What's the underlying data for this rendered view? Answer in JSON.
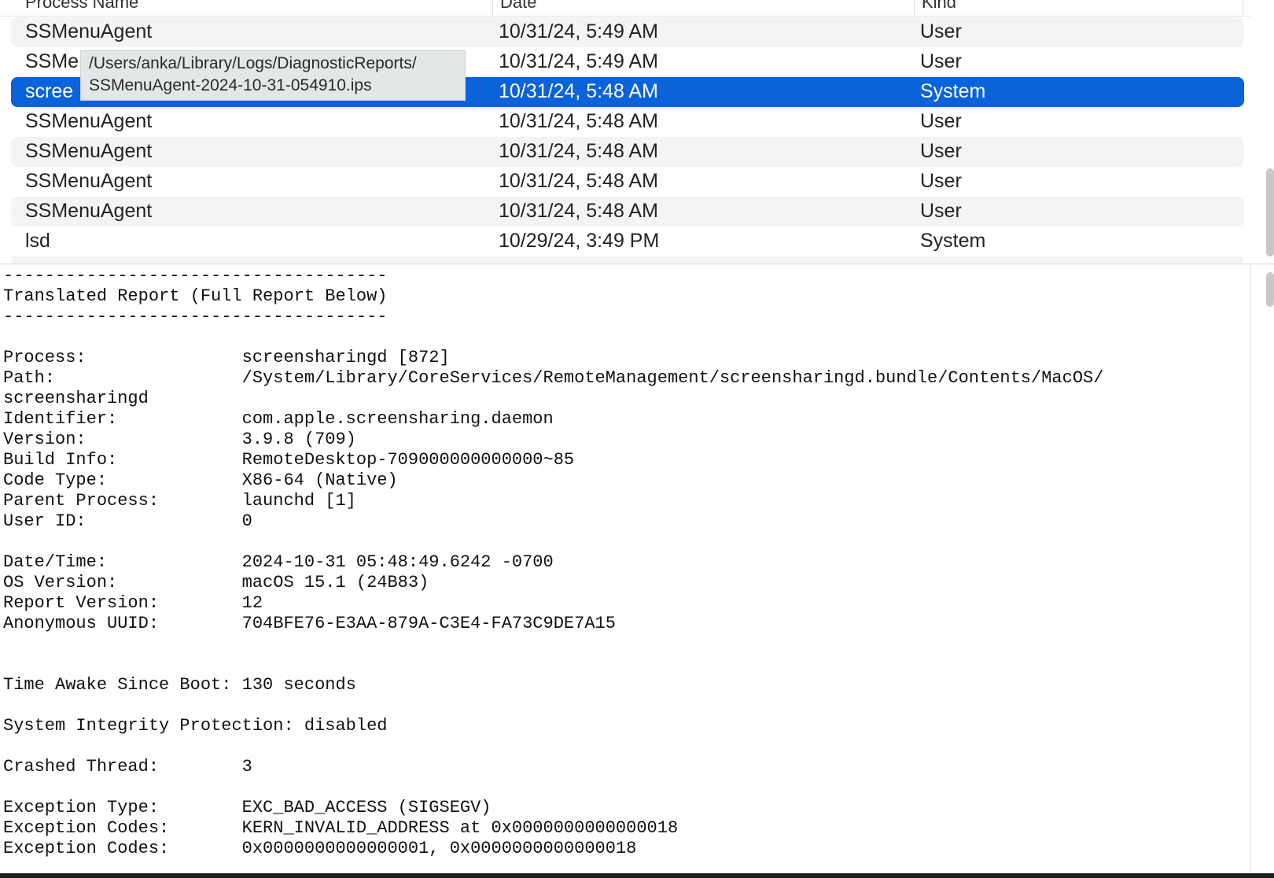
{
  "list": {
    "headers": [
      "Process Name",
      "Date",
      "Kind"
    ],
    "rows": [
      {
        "process": "SSMenuAgent",
        "date": "10/31/24, 5:49 AM",
        "kind": "User"
      },
      {
        "process": "SSMe",
        "date": "10/31/24, 5:49 AM",
        "kind": "User"
      },
      {
        "process": "scree",
        "date": "10/31/24, 5:48 AM",
        "kind": "System"
      },
      {
        "process": "SSMenuAgent",
        "date": "10/31/24, 5:48 AM",
        "kind": "User"
      },
      {
        "process": "SSMenuAgent",
        "date": "10/31/24, 5:48 AM",
        "kind": "User"
      },
      {
        "process": "SSMenuAgent",
        "date": "10/31/24, 5:48 AM",
        "kind": "User"
      },
      {
        "process": "SSMenuAgent",
        "date": "10/31/24, 5:48 AM",
        "kind": "User"
      },
      {
        "process": "lsd",
        "date": "10/29/24, 3:49 PM",
        "kind": "System"
      }
    ],
    "selected_index": 2
  },
  "tooltip": {
    "line1": "/Users/anka/Library/Logs/DiagnosticReports/",
    "line2": "SSMenuAgent-2024-10-31-054910.ips"
  },
  "report": {
    "text": "-------------------------------------\nTranslated Report (Full Report Below)\n-------------------------------------\n\nProcess:               screensharingd [872]\nPath:                  /System/Library/CoreServices/RemoteManagement/screensharingd.bundle/Contents/MacOS/\nscreensharingd\nIdentifier:            com.apple.screensharing.daemon\nVersion:               3.9.8 (709)\nBuild Info:            RemoteDesktop-709000000000000~85\nCode Type:             X86-64 (Native)\nParent Process:        launchd [1]\nUser ID:               0\n\nDate/Time:             2024-10-31 05:48:49.6242 -0700\nOS Version:            macOS 15.1 (24B83)\nReport Version:        12\nAnonymous UUID:        704BFE76-E3AA-879A-C3E4-FA73C9DE7A15\n\n\nTime Awake Since Boot: 130 seconds\n\nSystem Integrity Protection: disabled\n\nCrashed Thread:        3\n\nException Type:        EXC_BAD_ACCESS (SIGSEGV)\nException Codes:       KERN_INVALID_ADDRESS at 0x0000000000000018\nException Codes:       0x0000000000000001, 0x0000000000000018"
  },
  "colors": {
    "selection": "#0b63d9",
    "alt_row": "#f4f4f5",
    "tooltip_bg": "#e4e7e7"
  }
}
